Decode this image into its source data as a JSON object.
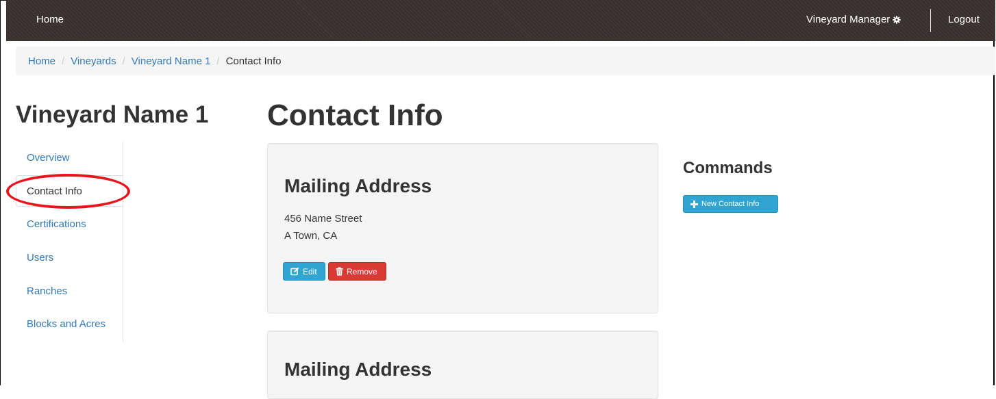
{
  "navbar": {
    "home_label": "Home",
    "user_menu_label": "Vineyard Manager",
    "logout_label": "Logout"
  },
  "breadcrumb": {
    "items": [
      "Home",
      "Vineyards",
      "Vineyard Name 1"
    ],
    "separator": "/",
    "active": "Contact Info"
  },
  "sidebar": {
    "title": "Vineyard Name 1",
    "items": [
      {
        "label": "Overview"
      },
      {
        "label": "Contact Info",
        "active": true
      },
      {
        "label": "Certifications"
      },
      {
        "label": "Users"
      },
      {
        "label": "Ranches"
      },
      {
        "label": "Blocks and Acres"
      }
    ]
  },
  "main": {
    "title": "Contact Info",
    "cards": [
      {
        "title": "Mailing Address",
        "address_line1": "456 Name Street",
        "address_line2": "A Town, CA",
        "edit_label": "Edit",
        "remove_label": "Remove"
      },
      {
        "title": "Mailing Address"
      }
    ]
  },
  "commands": {
    "title": "Commands",
    "new_contact_label": "New Contact Info"
  },
  "colors": {
    "navbar_bg": "#3a3230",
    "link": "#337ab7",
    "info_button": "#31a5d2",
    "danger_button": "#d83a36",
    "annotation": "#e8141b"
  },
  "icons": [
    "gear-icon",
    "edit-icon",
    "trash-icon",
    "plus-icon"
  ]
}
